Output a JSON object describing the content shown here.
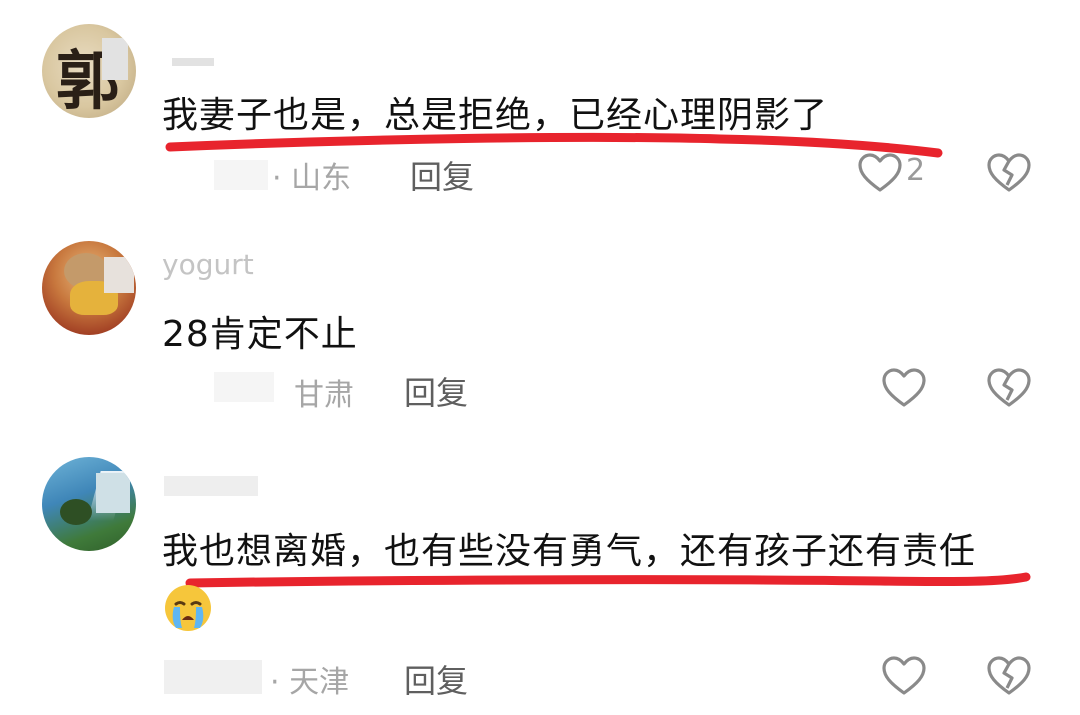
{
  "comments": [
    {
      "username": "",
      "text": "我妻子也是，总是拒绝，已经心理阴影了",
      "location": "· 山东",
      "reply": "回复",
      "likes": "2",
      "highlighted": true
    },
    {
      "username": "yogurt",
      "text": "28肯定不止",
      "location": "甘肃",
      "reply": "回复",
      "likes": "",
      "highlighted": false
    },
    {
      "username": "",
      "text": "我也想离婚，也有些没有勇气，还有孩子还有责任",
      "location": "· 天津",
      "reply": "回复",
      "likes": "",
      "highlighted": true,
      "emoji": "crying-face"
    }
  ],
  "colors": {
    "highlight": "#e8242d",
    "heart": "#8a8a8a"
  }
}
